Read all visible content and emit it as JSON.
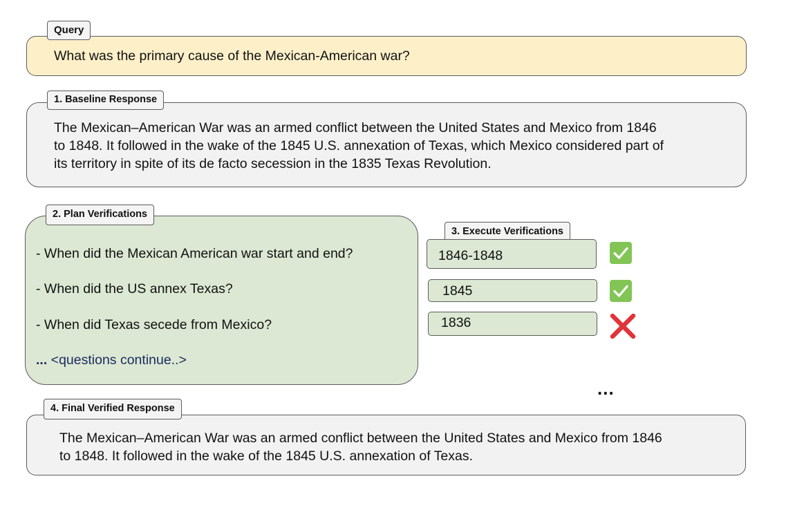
{
  "query": {
    "label": "Query",
    "text": "What was the primary cause of the Mexican-American war?"
  },
  "baseline": {
    "label": "1. Baseline Response",
    "lines": [
      "The Mexican–American War was an armed conflict between the United States and Mexico from 1846",
      "to 1848. It followed in the wake of the 1845 U.S. annexation of Texas, which Mexico considered part of",
      "its territory in spite of its de facto secession in the 1835 Texas Revolution."
    ]
  },
  "plan": {
    "label": "2. Plan Verifications",
    "questions": [
      "- When did the Mexican American war start and end?",
      "- When did the US annex Texas?",
      "- When did Texas secede from Mexico?"
    ],
    "more_dots": "...",
    "more_text": " <questions continue..>"
  },
  "execute": {
    "label": "3. Execute Verifications",
    "answers": [
      {
        "text": "1846-1848",
        "status": "verified",
        "icon": "check-mark-icon",
        "color": "#82c556"
      },
      {
        "text": "1845",
        "status": "verified",
        "icon": "check-mark-icon",
        "color": "#82c556"
      },
      {
        "text": "1836",
        "status": "rejected",
        "icon": "cross-mark-icon",
        "color": "#e0343a"
      }
    ],
    "ellipsis": "..."
  },
  "final": {
    "label": "4. Final Verified Response",
    "lines": [
      "The Mexican–American War was an armed conflict between the United States and Mexico from 1846",
      "to 1848. It followed in the wake of the 1845 U.S. annexation of Texas."
    ]
  },
  "colors": {
    "query_bg": "#fdf0c9",
    "plan_bg": "#dce8d3",
    "response_bg": "#f2f2f2",
    "check_green": "#82c556",
    "cross_red": "#e0343a"
  }
}
